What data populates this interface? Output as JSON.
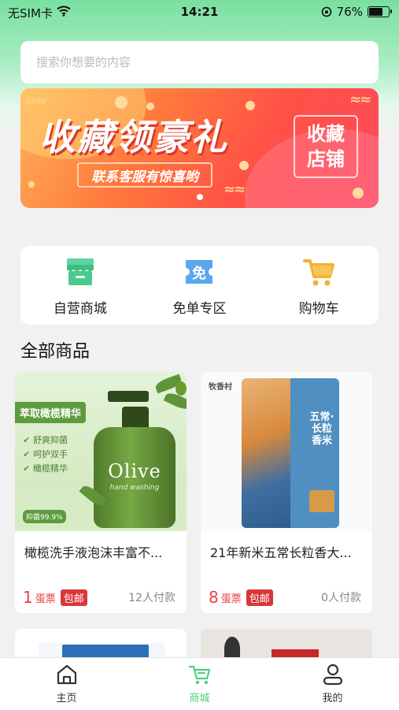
{
  "status_bar": {
    "carrier": "无SIM卡",
    "time": "14:21",
    "battery": "76%",
    "battery_level": 0.76
  },
  "search": {
    "placeholder": "搜索你想要的内容"
  },
  "banner": {
    "title": "收藏领豪礼",
    "subtitle": "联系客服有惊喜哟",
    "stamp_line1": "收藏",
    "stamp_line2": "店铺"
  },
  "quick_menu": [
    {
      "label": "自营商城",
      "icon": "store-icon",
      "color": "#4cc98f"
    },
    {
      "label": "免单专区",
      "icon": "free-order-icon",
      "color": "#5aa7ee"
    },
    {
      "label": "购物车",
      "icon": "cart-icon",
      "color": "#f4b233"
    }
  ],
  "section_title": "全部商品",
  "products": [
    {
      "name": "橄榄洗手液泡沫丰富不...",
      "price": "1",
      "unit": "蛋票",
      "tag": "包邮",
      "paid": "12人付款",
      "image": {
        "title": "萃取橄榄精华",
        "features": [
          "舒爽抑菌",
          "呵护双手",
          "橄榄精华"
        ],
        "label": "Olive",
        "sub": "hand washing",
        "badge": "抑菌99.9%"
      }
    },
    {
      "name": "21年新米五常长粒香大...",
      "price": "8",
      "unit": "蛋票",
      "tag": "包邮",
      "paid": "0人付款",
      "image": {
        "brand": "牧香村",
        "bag_text": "五常·长粒香米"
      }
    }
  ],
  "tabbar": [
    {
      "label": "主页",
      "icon": "home-icon",
      "active": false
    },
    {
      "label": "商城",
      "icon": "cart-icon",
      "active": true
    },
    {
      "label": "我的",
      "icon": "user-icon",
      "active": false
    }
  ],
  "colors": {
    "accent": "#4ccf7f",
    "price": "#e8413c",
    "tag": "#d9363a"
  }
}
